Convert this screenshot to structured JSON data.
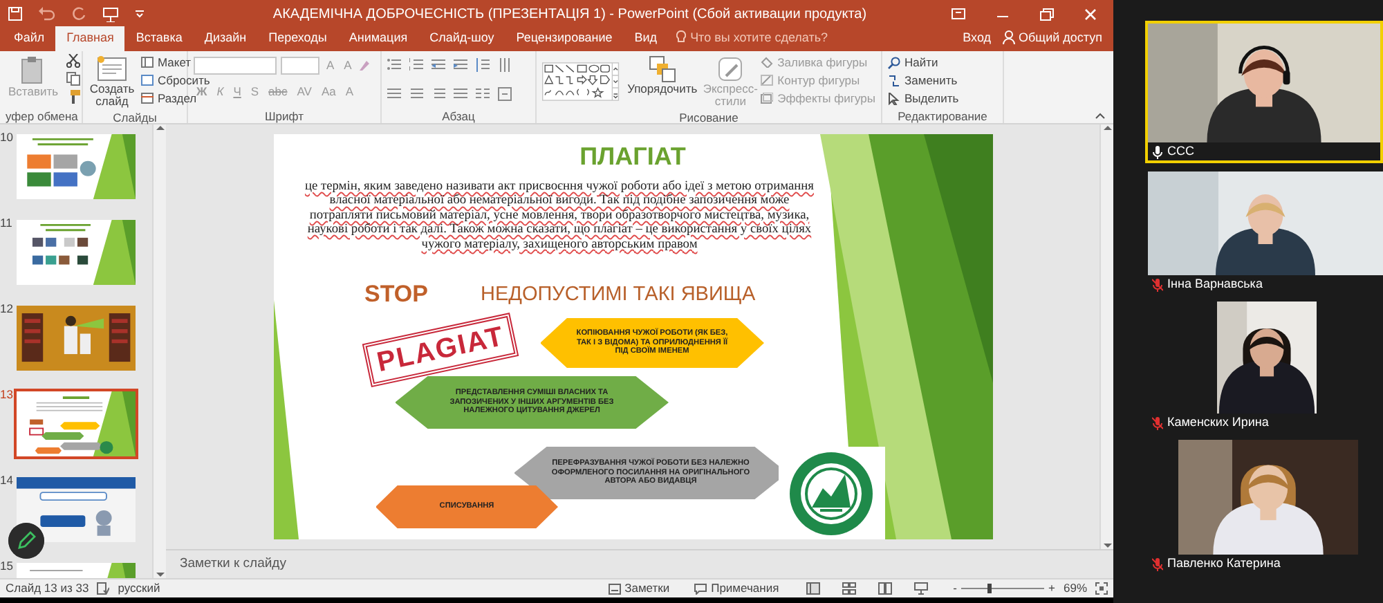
{
  "window": {
    "title": "АКАДЕМІЧНА ДОБРОЧЕСНІСТЬ (ПРЕЗЕНТАЦІЯ 1) - PowerPoint (Сбой активации продукта)"
  },
  "tabs": [
    {
      "label": "Файл",
      "selected": false
    },
    {
      "label": "Главная",
      "selected": true
    },
    {
      "label": "Вставка",
      "selected": false
    },
    {
      "label": "Дизайн",
      "selected": false
    },
    {
      "label": "Переходы",
      "selected": false
    },
    {
      "label": "Анимация",
      "selected": false
    },
    {
      "label": "Слайд-шоу",
      "selected": false
    },
    {
      "label": "Рецензирование",
      "selected": false
    },
    {
      "label": "Вид",
      "selected": false
    }
  ],
  "tell_me": {
    "placeholder": "Что вы хотите сделать?"
  },
  "account": {
    "sign_in": "Вход",
    "share": "Общий доступ"
  },
  "ribbon": {
    "clipboard": {
      "label": "уфер обмена",
      "paste": "Вставить"
    },
    "slides": {
      "label": "Слайды",
      "new_slide": "Создать слайд",
      "layout": "Макет",
      "reset": "Сбросить",
      "section": "Раздел"
    },
    "font": {
      "label": "Шрифт",
      "size_buttons": [
        "A",
        "A"
      ],
      "style_buttons": [
        "Ж",
        "К",
        "Ч",
        "S",
        "abc",
        "AV",
        "Aa"
      ],
      "color_button": "A"
    },
    "paragraph": {
      "label": "Абзац"
    },
    "drawing": {
      "label": "Рисование",
      "arrange": "Упорядочить",
      "quick_styles": {
        "label": "Экспресс-стили",
        "disabled": true
      },
      "shape_options": [
        {
          "label": "Заливка фигуры",
          "disabled": true
        },
        {
          "label": "Контур фигуры",
          "disabled": true
        },
        {
          "label": "Эффекты фигуры",
          "disabled": true
        }
      ]
    },
    "editing": {
      "label": "Редактирование",
      "commands": [
        "Найти",
        "Заменить",
        "Выделить"
      ]
    }
  },
  "thumbnails": [
    {
      "number": "10",
      "selected": false
    },
    {
      "number": "11",
      "selected": false
    },
    {
      "number": "12",
      "selected": false
    },
    {
      "number": "13",
      "selected": true
    },
    {
      "number": "14",
      "selected": false
    },
    {
      "number": "15",
      "selected": false
    }
  ],
  "slide": {
    "title": "ПЛАГІАТ",
    "definition": "це термін, яким заведено називати акт присвоєння чужої роботи або ідеї з метою отримання власної матеріальної або нематеріальної вигоди. Так під подібне запозичення може потрапляти письмовий матеріал, усне мовлення, твори образотворчого мистецтва, музика, наукові роботи і так далі. Також можна сказати, що плагіат – це використання у своїх цілях чужого матеріалу, захищеного авторським правом",
    "stop": "STOP",
    "heading": "НЕДОПУСТИМІ ТАКІ ЯВИЩА",
    "stamp": "PLAGIAT",
    "items": [
      {
        "text": "КОПІЮВАННЯ ЧУЖОЇ РОБОТИ (ЯК БЕЗ, ТАК І З ВІДОМА) ТА ОПРИЛЮДНЕННЯ ЇЇ ПІД СВОЇМ ІМЕНЕМ",
        "color": "#ffc000"
      },
      {
        "text": "ПРЕДСТАВЛЕННЯ СУМІШІ ВЛАСНИХ ТА ЗАПОЗИЧЕНИХ У ІНШИХ АРГУМЕНТІВ БЕЗ НАЛЕЖНОГО ЦИТУВАННЯ ДЖЕРЕЛ",
        "color": "#70ad47"
      },
      {
        "text": "ПЕРЕФРАЗУВАННЯ ЧУЖОЇ РОБОТИ БЕЗ НАЛЕЖНО ОФОРМЛЕНОГО ПОСИЛАННЯ НА ОРИГІНАЛЬНОГО АВТОРА АБО ВИДАВЦЯ",
        "color": "#a5a5a5"
      },
      {
        "text": "СПИСУВАННЯ",
        "color": "#ed7d31"
      }
    ]
  },
  "notes": {
    "placeholder": "Заметки к слайду"
  },
  "status_bar": {
    "slide": "Слайд 13 из 33",
    "language": "русский",
    "notes": "Заметки",
    "comments": "Примечания",
    "zoom_out": "-",
    "zoom_in": "+",
    "zoom": {
      "level": 0.33,
      "reading": "69%"
    }
  },
  "participants": [
    {
      "name": "ССС",
      "speaking": true,
      "muted": false
    },
    {
      "name": "Інна Варнавська",
      "speaking": false,
      "muted": true
    },
    {
      "name": "Каменских Ирина",
      "speaking": false,
      "muted": true
    },
    {
      "name": "Павленко Катерина",
      "speaking": false,
      "muted": true
    }
  ]
}
